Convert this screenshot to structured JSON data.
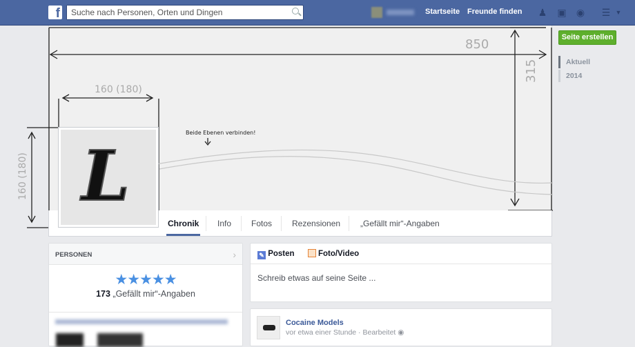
{
  "header": {
    "search_placeholder": "Suche nach Personen, Orten und Dingen",
    "nav": [
      "Startseite",
      "Freunde finden"
    ],
    "logo": "f"
  },
  "annotations": {
    "width": "850",
    "height": "315",
    "pic_width": "160 (180)",
    "pic_height": "160 (180)",
    "note": "Beide Ebenen verbinden!"
  },
  "profile": {
    "letter": "L"
  },
  "tabs": [
    "Chronik",
    "Info",
    "Fotos",
    "Rezensionen",
    "„Gefällt mir“-Angaben"
  ],
  "sidebar": {
    "create_page": "Seite erstellen",
    "timeline": [
      "Aktuell",
      "2014"
    ]
  },
  "people": {
    "title": "PERSONEN",
    "rating": "★★★★★",
    "likes_count": "173",
    "likes_label": "„Gefällt mir“-Angaben"
  },
  "composer": {
    "tabs": [
      "Posten",
      "Foto/Video"
    ],
    "placeholder": "Schreib etwas auf seine Seite ..."
  },
  "post": {
    "author": "Cocaine Models",
    "meta": "vor etwa einer Stunde · Bearbeitet"
  },
  "colors": {
    "brand": "#4b67a1",
    "green": "#5eaf2d",
    "star": "#4a90e2"
  }
}
